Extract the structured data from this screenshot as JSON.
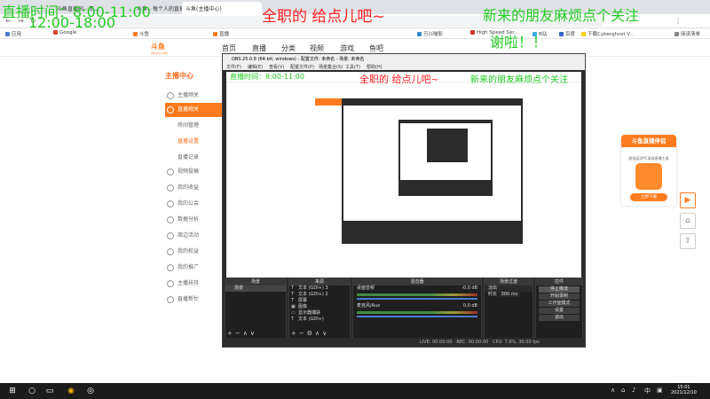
{
  "browser": {
    "tabs": [
      {
        "label": "斗鱼直播间 - 王..."
      },
      {
        "label": "斗鱼 - 每个人的直播平台"
      },
      {
        "label": "斗鱼(主播中心)"
      }
    ],
    "bookmarks": [
      {
        "label": "应用",
        "color": "#4a7bd0"
      },
      {
        "label": "Google",
        "color": "#dd4433"
      },
      {
        "label": "斗鱼",
        "color": "#ff7b1e"
      },
      {
        "label": "直播",
        "color": "#ff7b1e"
      },
      {
        "label": "High Speed Ser...",
        "color": "#cc3333"
      },
      {
        "label": "万兴喵影",
        "color": "#3388cc"
      },
      {
        "label": "B站",
        "color": "#33aadd"
      },
      {
        "label": "百度",
        "color": "#3366cc"
      },
      {
        "label": "下载Cyberghost V...",
        "color": "#ffcc00"
      },
      {
        "label": "阅读清单",
        "color": "#888888"
      }
    ]
  },
  "site": {
    "logo": "斗鱼",
    "logo_sub": "douyu.com",
    "nav": [
      "首页",
      "直播",
      "分类",
      "视频",
      "游戏",
      "鱼吧"
    ],
    "sidebar_title": "主播中心",
    "sidebar_items": [
      {
        "label": "主播频关",
        "active": false,
        "sub": false
      },
      {
        "label": "直播相关",
        "active": true,
        "sub": false
      },
      {
        "label": "房间管理",
        "active": false,
        "sub": true
      },
      {
        "label": "直播设置",
        "active": false,
        "sub": true
      },
      {
        "label": "直播记录",
        "active": false,
        "sub": true
      },
      {
        "label": "视频投稿",
        "active": false,
        "sub": false
      },
      {
        "label": "我的收益",
        "active": false,
        "sub": false
      },
      {
        "label": "我的公会",
        "active": false,
        "sub": false
      },
      {
        "label": "数据分析",
        "active": false,
        "sub": false
      },
      {
        "label": "周边活动",
        "active": false,
        "sub": false
      },
      {
        "label": "我的权益",
        "active": false,
        "sub": false
      },
      {
        "label": "我的推广",
        "active": false,
        "sub": false
      },
      {
        "label": "主播扶持",
        "active": false,
        "sub": false
      },
      {
        "label": "直播帮忙",
        "active": false,
        "sub": false
      }
    ]
  },
  "obs": {
    "title": "OBS 25.0.8 (64-bit, windows) - 配置文件: 未命名 - 场景: 未命名",
    "menu": [
      "文件(F)",
      "编辑(E)",
      "查看(V)",
      "配置文件(P)",
      "场景集合(S)",
      "工具(T)",
      "帮助(H)"
    ],
    "docks": {
      "scenes": {
        "title": "场景",
        "items": [
          "场景"
        ]
      },
      "sources": {
        "title": "来源",
        "items": [
          {
            "icon": "T",
            "label": "文本 (GDI+) 3"
          },
          {
            "icon": "T",
            "label": "文本 (GDI+) 2"
          },
          {
            "icon": "T",
            "label": "屏幕"
          },
          {
            "icon": "▣",
            "label": "图像"
          },
          {
            "icon": "▭",
            "label": "显示器捕获"
          },
          {
            "icon": "T",
            "label": "文本 (GDI+)"
          }
        ]
      },
      "mixer": {
        "title": "混音器",
        "tracks": [
          {
            "name": "桌面音频",
            "db": "-0.0 dB"
          },
          {
            "name": "麦克风/Aux",
            "db": "0.0 dB"
          }
        ]
      },
      "transitions": {
        "title": "场景过渡",
        "type": "淡出",
        "duration_label": "时长",
        "duration": "300 ms"
      },
      "controls": {
        "title": "控件",
        "buttons": [
          "停止推流",
          "开始录制",
          "工作室模式",
          "设置",
          "退出"
        ]
      }
    },
    "status": {
      "live": "LIVE: 00:00:00",
      "rec": "REC: 00:00:00",
      "cpu": "CPU: 7.9%, 30.00 fps"
    }
  },
  "promo": {
    "title": "斗鱼直播伴侣",
    "sub": "超低延迟PC高效直播工具",
    "button": "立即下载"
  },
  "overlays": {
    "schedule_line1": "直播时间：8:00-11:00",
    "schedule_line2": "12:00-18:00",
    "fulltime": "全职的 给点儿吧~",
    "newfriends_line1": "新来的朋友麻烦点个关注",
    "newfriends_line2": "谢啦！！",
    "inner_fulltime": "全职的 给点儿吧~",
    "inner_newfriends": "新来的朋友麻烦点个关注"
  },
  "taskbar": {
    "time": "15:01",
    "date": "2021/12/10"
  }
}
